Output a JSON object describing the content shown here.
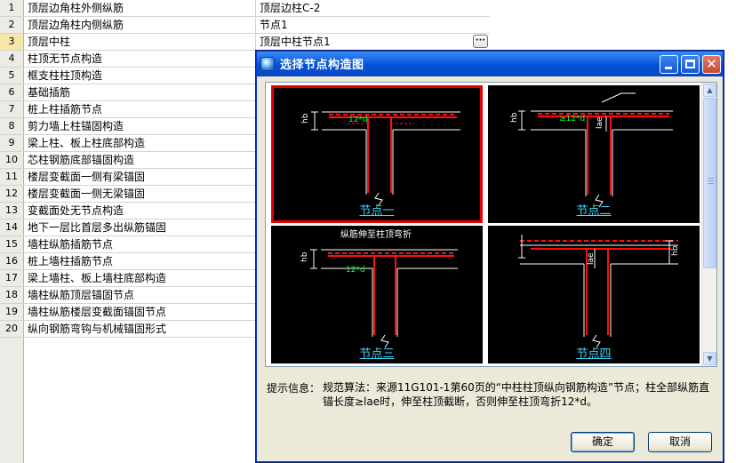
{
  "grid": {
    "rows": [
      {
        "num": "1",
        "name": "顶层边角柱外侧纵筋",
        "value": "顶层边柱C-2"
      },
      {
        "num": "2",
        "name": "顶层边角柱内侧纵筋",
        "value": "节点1"
      },
      {
        "num": "3",
        "name": "顶层中柱",
        "value": "顶层中柱节点1"
      },
      {
        "num": "4",
        "name": "柱顶无节点构造",
        "value": ""
      },
      {
        "num": "5",
        "name": "框支柱柱顶构造",
        "value": ""
      },
      {
        "num": "6",
        "name": "基础插筋",
        "value": ""
      },
      {
        "num": "7",
        "name": "桩上柱插筋节点",
        "value": ""
      },
      {
        "num": "8",
        "name": "剪力墙上柱锚固构造",
        "value": ""
      },
      {
        "num": "9",
        "name": "梁上柱、板上柱底部构造",
        "value": ""
      },
      {
        "num": "10",
        "name": "芯柱钢筋底部锚固构造",
        "value": ""
      },
      {
        "num": "11",
        "name": "楼层变截面一侧有梁锚固",
        "value": ""
      },
      {
        "num": "12",
        "name": "楼层变截面一侧无梁锚固",
        "value": ""
      },
      {
        "num": "13",
        "name": "变截面处无节点构造",
        "value": ""
      },
      {
        "num": "14",
        "name": "地下一层比首层多出纵筋锚固",
        "value": ""
      },
      {
        "num": "15",
        "name": "墙柱纵筋插筋节点",
        "value": ""
      },
      {
        "num": "16",
        "name": "桩上墙柱插筋节点",
        "value": ""
      },
      {
        "num": "17",
        "name": "梁上墙柱、板上墙柱底部构造",
        "value": ""
      },
      {
        "num": "18",
        "name": "墙柱纵筋顶层锚固节点",
        "value": ""
      },
      {
        "num": "19",
        "name": "墙柱纵筋楼层变截面锚固节点",
        "value": ""
      },
      {
        "num": "20",
        "name": "纵向钢筋弯钩与机械锚固形式",
        "value": ""
      }
    ],
    "ellipsis_label": "···"
  },
  "dialog": {
    "title": "选择节点构造图",
    "close_label": "✕",
    "tiles": [
      {
        "caption": "节点一",
        "dim_label": "12*d",
        "hb_label": "hb"
      },
      {
        "caption": "节点二",
        "dim_label": "≥12*d",
        "hb_label": "hb",
        "lae_label": "lae"
      },
      {
        "caption": "节点三",
        "dim_label": "12*d",
        "hb_label": "hb",
        "top_note": "纵筋伸至柱顶弯折"
      },
      {
        "caption": "节点四",
        "hb_label": "hb",
        "lae_label": "lae"
      }
    ],
    "hint_label": "提示信息：",
    "hint_text": "规范算法：来源11G101-1第60页的“中柱柱顶纵向钢筋构造”节点；柱全部纵筋直锚长度≥lae时，伸至柱顶截断，否则伸至柱顶弯折12*d。",
    "ok_label": "确定",
    "cancel_label": "取消"
  },
  "colors": {
    "dialog_face": "#ece9d8",
    "titlebar": "#0a5fe0",
    "rebar": "#ff1010",
    "caption": "#3cd6ff",
    "selection": "#e60000"
  }
}
